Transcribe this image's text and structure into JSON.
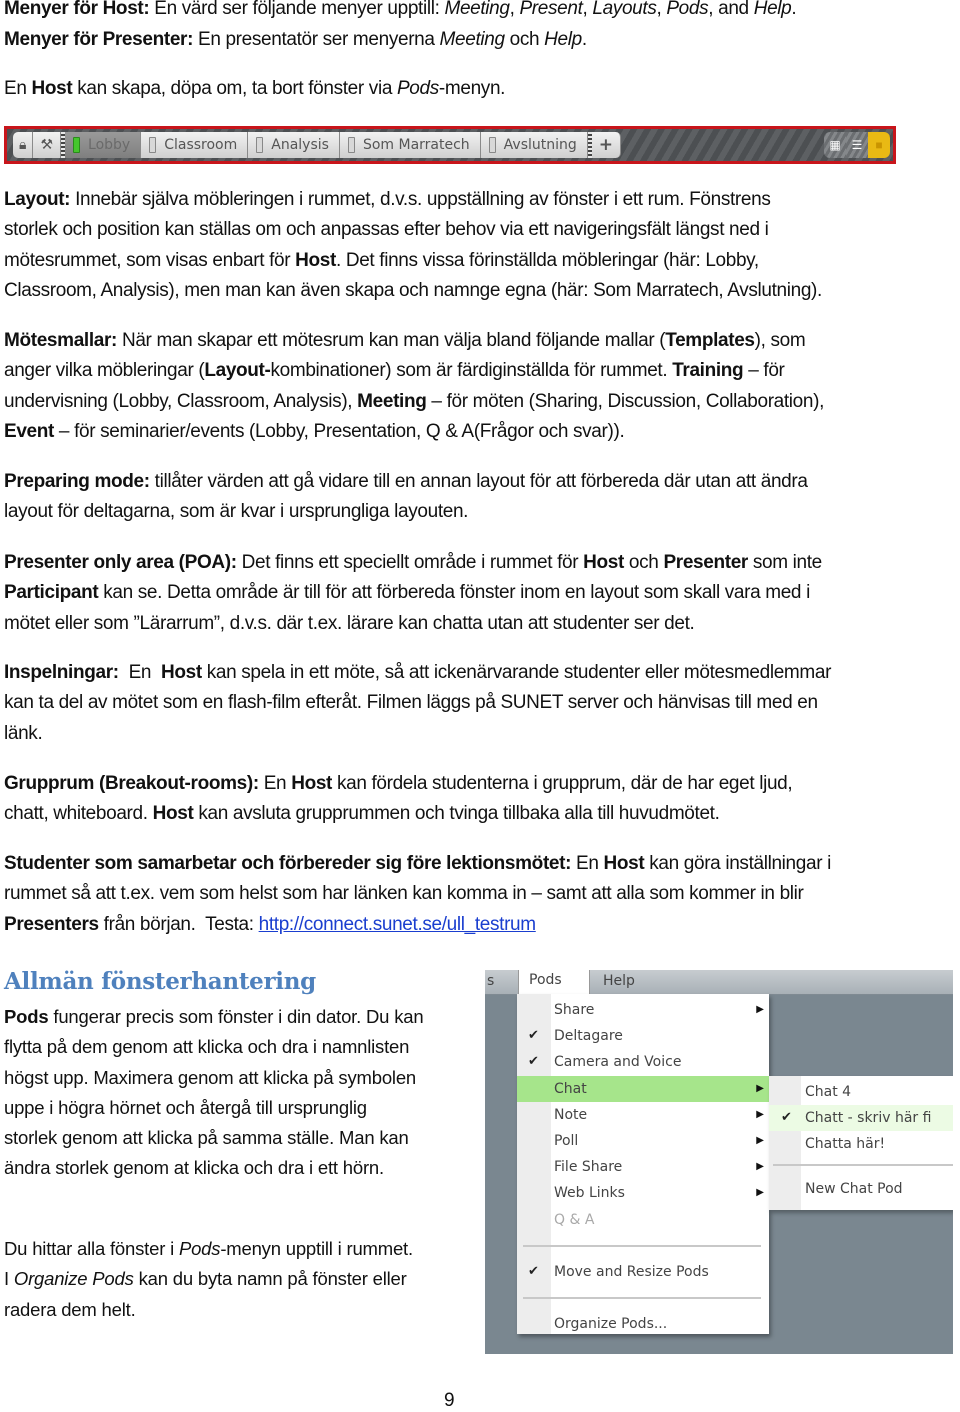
{
  "intro": {
    "host_menus_label": "Menyer för Host:",
    "host_menus_text": " En värd ser följande menyer upptill: ",
    "host_menus_items": [
      "Meeting",
      "Present",
      "Layouts",
      "Pods"
    ],
    "host_menus_and": ", and ",
    "host_menus_last": "Help",
    "presenter_menus_label": "Menyer för Presenter:",
    "presenter_menus_text": " En presentatör ser menyerna ",
    "presenter_menu_1": "Meeting",
    "presenter_and": " och ",
    "presenter_menu_2": "Help",
    "pods_line_pre": "En ",
    "pods_line_host": "Host",
    "pods_line_mid": " kan skapa, döpa om, ta bort fönster via ",
    "pods_line_pods": "Pods",
    "pods_line_post": "-menyn."
  },
  "toolbar": {
    "left_icons": [
      "lock-icon",
      "tools-icon"
    ],
    "tabs": [
      {
        "label": "Lobby",
        "active": true
      },
      {
        "label": "Classroom",
        "active": false
      },
      {
        "label": "Analysis",
        "active": false
      },
      {
        "label": "Som Marratech",
        "active": false
      },
      {
        "label": "Avslutning",
        "active": false
      }
    ],
    "add_label": "+",
    "right_icons": [
      "grid-icon",
      "list-icon",
      "layout-square-icon"
    ],
    "colors": {
      "border": "#c8151b",
      "active_indicator": "#45c62d",
      "highlight": "#e9b914"
    }
  },
  "paragraphs": {
    "layout": {
      "label": "Layout:",
      "l1": " Innebär själva möbleringen i rummet, d.v.s. uppställning av fönster i ett rum. Fönstrens",
      "l2": "storlek och position kan ställas om och anpassas efter behov via ett navigeringsfält längst ned i",
      "l3a": "mötesrummet, som visas enbart för ",
      "l3b": "Host",
      "l3c": ". Det finns vissa förinställda möbleringar (här: Lobby,",
      "l4": "Classroom, Analysis), men man kan även skapa och namnge egna (här: Som Marratech, Avslutning)."
    },
    "templates": {
      "label": "Mötesmallar:",
      "l1a": " När man skapar ett mötesrum kan man välja bland följande mallar (",
      "l1b": "Templates",
      "l1c": "), som",
      "l2a": "anger vilka möbleringar (",
      "l2b": "Layout-",
      "l2c": "kombinationer) som är färdiginställda för rummet. ",
      "l2d": "Training",
      "l2e": " – för",
      "l3a": "undervisning (Lobby, Classroom, Analysis), ",
      "l3b": "Meeting",
      "l3c": " – för möten (Sharing, Discussion, Collaboration),",
      "l4a": "Event",
      "l4b": " – för seminarier/events (Lobby, Presentation, Q & A(Frågor och svar))."
    },
    "preparing": {
      "label": "Preparing mode:",
      "l1": " tillåter värden att gå vidare till en annan layout för att förbereda där utan att ändra",
      "l2": "layout för deltagarna, som är kvar i ursprungliga layouten."
    },
    "poa": {
      "label": "Presenter only area (POA):",
      "l1a": " Det finns ett speciellt område i rummet för ",
      "l1b": "Host",
      "l1c": " och ",
      "l1d": "Presenter",
      "l1e": " som inte",
      "l2a": "Participant",
      "l2b": " kan se. Detta område är till för att förbereda fönster inom en layout som skall vara med i",
      "l3": "mötet eller som ”Lärarrum”, d.v.s. där t.ex. lärare kan chatta utan att studenter ser det."
    },
    "recordings": {
      "label": "Inspelningar:",
      "l1a": "  En  ",
      "l1b": "Host",
      "l1c": " kan spela in ett möte, så att ickenärvarande studenter eller mötesmedlemmar",
      "l2": "kan ta del av mötet som en flash-film efteråt. Filmen läggs på SUNET server och hänvisas till med en",
      "l3": "länk."
    },
    "breakout": {
      "label": "Grupprum (Breakout-rooms):",
      "l1a": " En ",
      "l1b": "Host",
      "l1c": " kan fördela studenterna i grupprum, där de har eget ljud,",
      "l2a": "chatt, whiteboard. ",
      "l2b": "Host",
      "l2c": " kan avsluta grupprummen och tvinga tillbaka alla till huvudmötet."
    },
    "students": {
      "label": "Studenter som samarbetar och förbereder sig före lektionsmötet:",
      "l1a": " En ",
      "l1b": "Host",
      "l1c": " kan göra inställningar i",
      "l2": "rummet så att t.ex. vem som helst som har länken kan komma in – samt att alla som kommer in blir",
      "l3a": "Presenters",
      "l3b": " från början.  Testa: ",
      "link": "http://connect.sunet.se/ull_testrum"
    }
  },
  "section": {
    "heading": "Allmän fönsterhantering",
    "p1_bold": "Pods",
    "p1_lines": [
      " fungerar precis som fönster i din dator. Du kan",
      "flytta på dem genom att klicka och dra i namnlisten",
      "högst upp. Maximera genom att klicka på symbolen",
      "uppe i högra hörnet och återgå till ursprunglig",
      "storlek genom att klicka på samma ställe. Man kan",
      "ändra storlek genom at klicka och dra i ett hörn."
    ],
    "p2_l1a": "Du hittar alla fönster i ",
    "p2_l1b": "Pods",
    "p2_l1c": "-menyn upptill i rummet.",
    "p2_l2a": "I ",
    "p2_l2b": "Organize Pods",
    "p2_l2c": " kan du byta namn på fönster eller",
    "p2_l3": "radera dem helt."
  },
  "menu_screenshot": {
    "menubar": {
      "partial_left": "s",
      "pods": "Pods",
      "help": "Help"
    },
    "pods_menu": [
      {
        "label": "Share",
        "checked": false,
        "submenu": true
      },
      {
        "label": "Deltagare",
        "checked": true,
        "submenu": false
      },
      {
        "label": "Camera and Voice",
        "checked": true,
        "submenu": false
      },
      {
        "label": "Chat",
        "checked": false,
        "submenu": true,
        "highlighted": true
      },
      {
        "label": "Note",
        "checked": false,
        "submenu": true
      },
      {
        "label": "Poll",
        "checked": false,
        "submenu": true
      },
      {
        "label": "File Share",
        "checked": false,
        "submenu": true
      },
      {
        "label": "Web Links",
        "checked": false,
        "submenu": true
      },
      {
        "label": "Q & A",
        "checked": false,
        "submenu": false,
        "disabled": true
      }
    ],
    "move_resize": {
      "label": "Move and Resize Pods",
      "checked": true
    },
    "organize": {
      "label": "Organize Pods..."
    },
    "chat_submenu": [
      {
        "label": "Chat 4",
        "checked": false
      },
      {
        "label": "Chatt - skriv här fi",
        "checked": true
      },
      {
        "label": "Chatta här!",
        "checked": false
      }
    ],
    "new_chat_pod": "New Chat Pod",
    "check_glyph": "✔",
    "arrow_glyph": "▶",
    "highlight_color": "#a6e58b"
  },
  "page_number": "9"
}
